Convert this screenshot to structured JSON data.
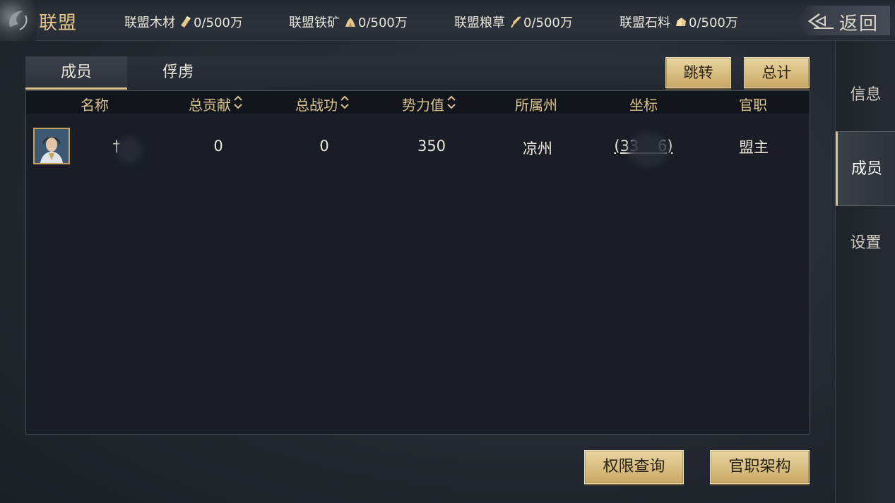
{
  "header": {
    "title": "联盟",
    "resources": [
      {
        "label": "联盟木材",
        "icon": "wood-icon",
        "value": "0/500万"
      },
      {
        "label": "联盟铁矿",
        "icon": "iron-ore-icon",
        "value": "0/500万"
      },
      {
        "label": "联盟粮草",
        "icon": "grain-icon",
        "value": "0/500万"
      },
      {
        "label": "联盟石料",
        "icon": "stone-icon",
        "value": "0/500万"
      }
    ],
    "back_label": "返回"
  },
  "sidenav": {
    "items": [
      {
        "label": "信息"
      },
      {
        "label": "成员"
      },
      {
        "label": "设置"
      }
    ],
    "active_index": 1
  },
  "tabs": [
    {
      "label": "成员"
    },
    {
      "label": "俘虏"
    }
  ],
  "active_tab": 0,
  "toolbar": {
    "jump_label": "跳转",
    "total_label": "总计"
  },
  "table": {
    "columns": [
      "名称",
      "总贡献",
      "总战功",
      "势力值",
      "所属州",
      "坐标",
      "官职"
    ],
    "sortable_columns": [
      "总贡献",
      "总战功",
      "势力值"
    ],
    "rows": [
      {
        "name": "†",
        "contribution": "0",
        "merit": "0",
        "power": "350",
        "state": "凉州",
        "coord": "(33    6)",
        "position": "盟主"
      }
    ]
  },
  "footer": {
    "permissions_label": "权限查询",
    "structure_label": "官职架构"
  },
  "colors": {
    "accent_gold": "#d9c28a",
    "header_gold": "#e6c88a",
    "panel_bg": "#1a1d26"
  }
}
